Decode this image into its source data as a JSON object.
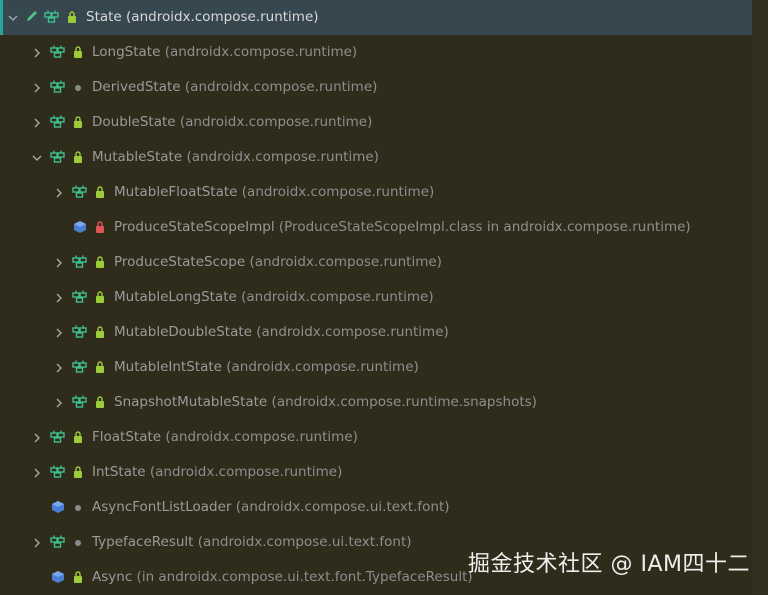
{
  "tree": {
    "items": [
      {
        "name": "State",
        "pkg": "(androidx.compose.runtime)",
        "selected": true,
        "expanded": true,
        "level": 0,
        "kind": "interface",
        "visibility": "public",
        "edit": true
      },
      {
        "name": "LongState",
        "pkg": "(androidx.compose.runtime)",
        "level": 1,
        "kind": "interface",
        "visibility": "public",
        "chevron": "collapsed"
      },
      {
        "name": "DerivedState",
        "pkg": "(androidx.compose.runtime)",
        "level": 1,
        "kind": "interface",
        "visibility": "package",
        "chevron": "collapsed"
      },
      {
        "name": "DoubleState",
        "pkg": "(androidx.compose.runtime)",
        "level": 1,
        "kind": "interface",
        "visibility": "public",
        "chevron": "collapsed"
      },
      {
        "name": "MutableState",
        "pkg": "(androidx.compose.runtime)",
        "level": 1,
        "kind": "interface",
        "visibility": "public",
        "chevron": "expanded"
      },
      {
        "name": "MutableFloatState",
        "pkg": "(androidx.compose.runtime)",
        "level": 2,
        "kind": "interface",
        "visibility": "public",
        "chevron": "collapsed"
      },
      {
        "name": "ProduceStateScopeImpl",
        "pkg": "(ProduceStateScopeImpl.class in androidx.compose.runtime)",
        "level": 2,
        "kind": "class",
        "visibility": "private",
        "chevron": "none"
      },
      {
        "name": "ProduceStateScope",
        "pkg": "(androidx.compose.runtime)",
        "level": 2,
        "kind": "interface",
        "visibility": "public",
        "chevron": "collapsed"
      },
      {
        "name": "MutableLongState",
        "pkg": "(androidx.compose.runtime)",
        "level": 2,
        "kind": "interface",
        "visibility": "public",
        "chevron": "collapsed"
      },
      {
        "name": "MutableDoubleState",
        "pkg": "(androidx.compose.runtime)",
        "level": 2,
        "kind": "interface",
        "visibility": "public",
        "chevron": "collapsed"
      },
      {
        "name": "MutableIntState",
        "pkg": "(androidx.compose.runtime)",
        "level": 2,
        "kind": "interface",
        "visibility": "public",
        "chevron": "collapsed"
      },
      {
        "name": "SnapshotMutableState",
        "pkg": "(androidx.compose.runtime.snapshots)",
        "level": 2,
        "kind": "interface",
        "visibility": "public",
        "chevron": "collapsed"
      },
      {
        "name": "FloatState",
        "pkg": "(androidx.compose.runtime)",
        "level": 1,
        "kind": "interface",
        "visibility": "public",
        "chevron": "collapsed"
      },
      {
        "name": "IntState",
        "pkg": "(androidx.compose.runtime)",
        "level": 1,
        "kind": "interface",
        "visibility": "public",
        "chevron": "collapsed"
      },
      {
        "name": "AsyncFontListLoader",
        "pkg": "(androidx.compose.ui.text.font)",
        "level": 1,
        "kind": "class",
        "visibility": "package",
        "chevron": "none"
      },
      {
        "name": "TypefaceResult",
        "pkg": "(androidx.compose.ui.text.font)",
        "level": 1,
        "kind": "interface",
        "visibility": "package",
        "chevron": "collapsed"
      },
      {
        "name": "Async",
        "pkg": "(in androidx.compose.ui.text.font.TypefaceResult)",
        "level": 1,
        "kind": "class",
        "visibility": "public",
        "chevron": "none"
      }
    ]
  },
  "watermark": "掘金技术社区 @ IAM四十二",
  "colors": {
    "background": "#2f2c1c",
    "selection": "#36474f",
    "accent": "#26a69a",
    "interface_icon": "#3fbf8f",
    "class_icon": "#4a7fd4",
    "lock_public": "#9ccc3a",
    "lock_private": "#e05555"
  },
  "icons": [
    "chevron-right-icon",
    "chevron-down-icon",
    "edit-pencil-icon",
    "interface-icon",
    "class-icon",
    "public-lock-icon",
    "private-lock-icon",
    "package-dot-icon"
  ]
}
